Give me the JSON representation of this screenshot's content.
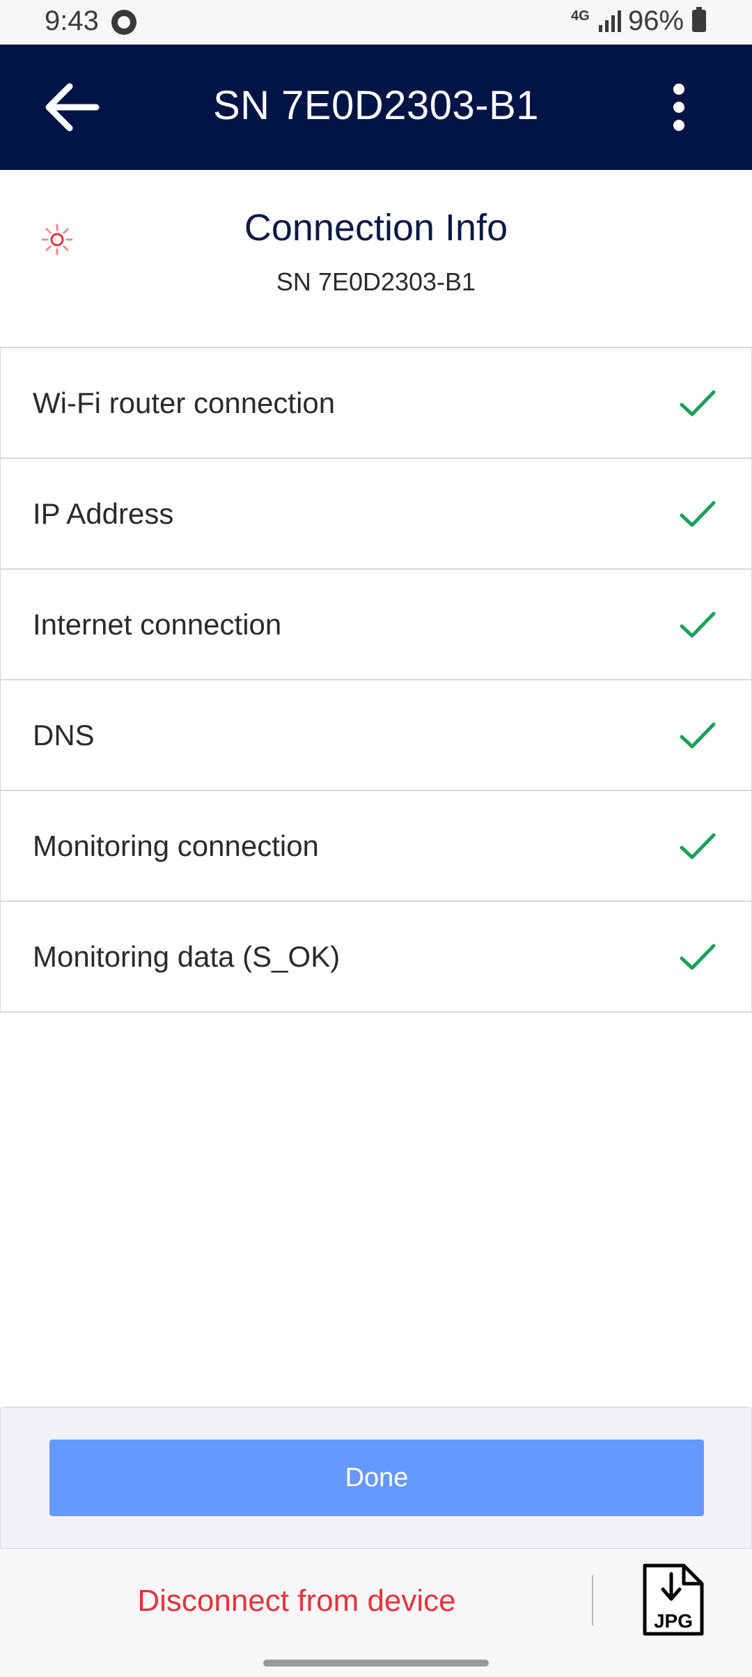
{
  "status_bar": {
    "time": "9:43",
    "network": "4G",
    "battery": "96%"
  },
  "app_bar": {
    "title": "SN 7E0D2303-B1",
    "back_icon": "arrow-left-icon",
    "menu_icon": "more-vertical-icon"
  },
  "header": {
    "title": "Connection Info",
    "subtitle": "SN 7E0D2303-B1",
    "status_icon": "status-light-icon"
  },
  "checks": [
    {
      "label": "Wi-Fi router connection",
      "status": "ok"
    },
    {
      "label": "IP Address",
      "status": "ok"
    },
    {
      "label": "Internet connection",
      "status": "ok"
    },
    {
      "label": "DNS",
      "status": "ok"
    },
    {
      "label": "Monitoring connection",
      "status": "ok"
    },
    {
      "label": "Monitoring data (S_OK)",
      "status": "ok"
    }
  ],
  "actions": {
    "done_label": "Done",
    "disconnect_label": "Disconnect from device",
    "export_label": "JPG"
  },
  "colors": {
    "app_bar": "#001446",
    "check": "#1aa05a",
    "done_button": "#6699ff",
    "disconnect": "#e5333a",
    "status_light": "#e5333a"
  }
}
